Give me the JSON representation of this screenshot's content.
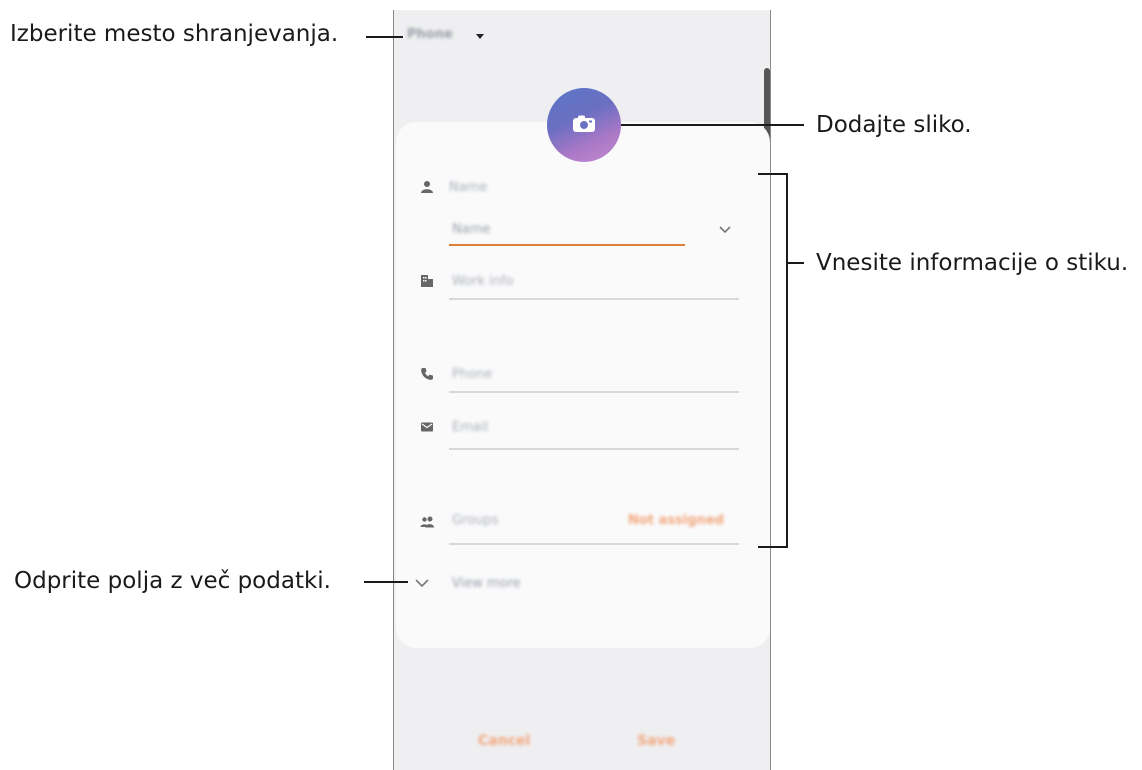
{
  "callouts": {
    "storage": "Izberite mesto shranjevanja.",
    "picture": "Dodajte sliko.",
    "info": "Vnesite informacije o stiku.",
    "more": "Odprite polja z več podatki."
  },
  "header": {
    "storage_value": "Phone"
  },
  "form": {
    "name_label": "Name",
    "name_field": "Name",
    "work_info": "Work info",
    "phone": "Phone",
    "email": "Email",
    "groups": "Groups",
    "groups_value": "Not assigned",
    "view_more": "View more"
  },
  "footer": {
    "cancel": "Cancel",
    "save": "Save"
  },
  "icons": [
    "caret-down-icon",
    "camera-icon",
    "person-icon",
    "building-icon",
    "phone-icon",
    "mail-icon",
    "group-icon",
    "chevron-down-icon"
  ],
  "colors": {
    "accent": "#e07f3a",
    "avatar_start": "#5b76c6",
    "avatar_end": "#c78ad1"
  }
}
